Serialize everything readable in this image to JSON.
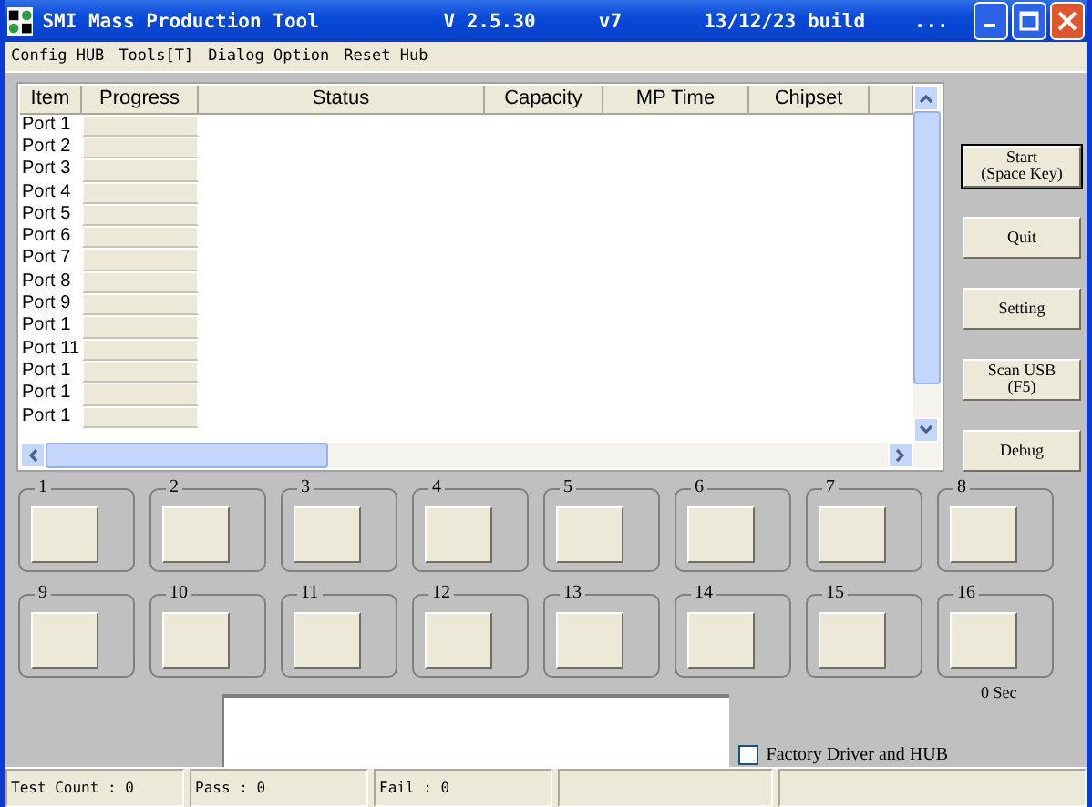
{
  "window": {
    "title": "SMI Mass Production Tool",
    "version": "V 2.5.30",
    "revision": "v7",
    "build": "13/12/23 build",
    "more": "..."
  },
  "menu": [
    "Config HUB",
    "Tools[T]",
    "Dialog Option",
    "Reset Hub"
  ],
  "table": {
    "columns": [
      "Item",
      "Progress",
      "Status",
      "Capacity",
      "MP Time",
      "Chipset"
    ],
    "rows": [
      "Port 1",
      "Port 2",
      "Port 3",
      "Port 4",
      "Port 5",
      "Port 6",
      "Port 7",
      "Port 8",
      "Port 9",
      "Port 1",
      "Port 11",
      "Port 1",
      "Port 1",
      "Port 1"
    ]
  },
  "buttons": [
    "Start\n(Space Key)",
    "Quit",
    "Setting",
    "Scan USB\n(F5)",
    "Debug"
  ],
  "ports": [
    "1",
    "2",
    "3",
    "4",
    "5",
    "6",
    "7",
    "8",
    "9",
    "10",
    "11",
    "12",
    "13",
    "14",
    "15",
    "16"
  ],
  "timer": "0 Sec",
  "factory_driver": {
    "label": "Factory Driver and HUB",
    "checked": false
  },
  "status_bar": [
    "Test Count : 0",
    "Pass : 0",
    "Fail : 0"
  ]
}
